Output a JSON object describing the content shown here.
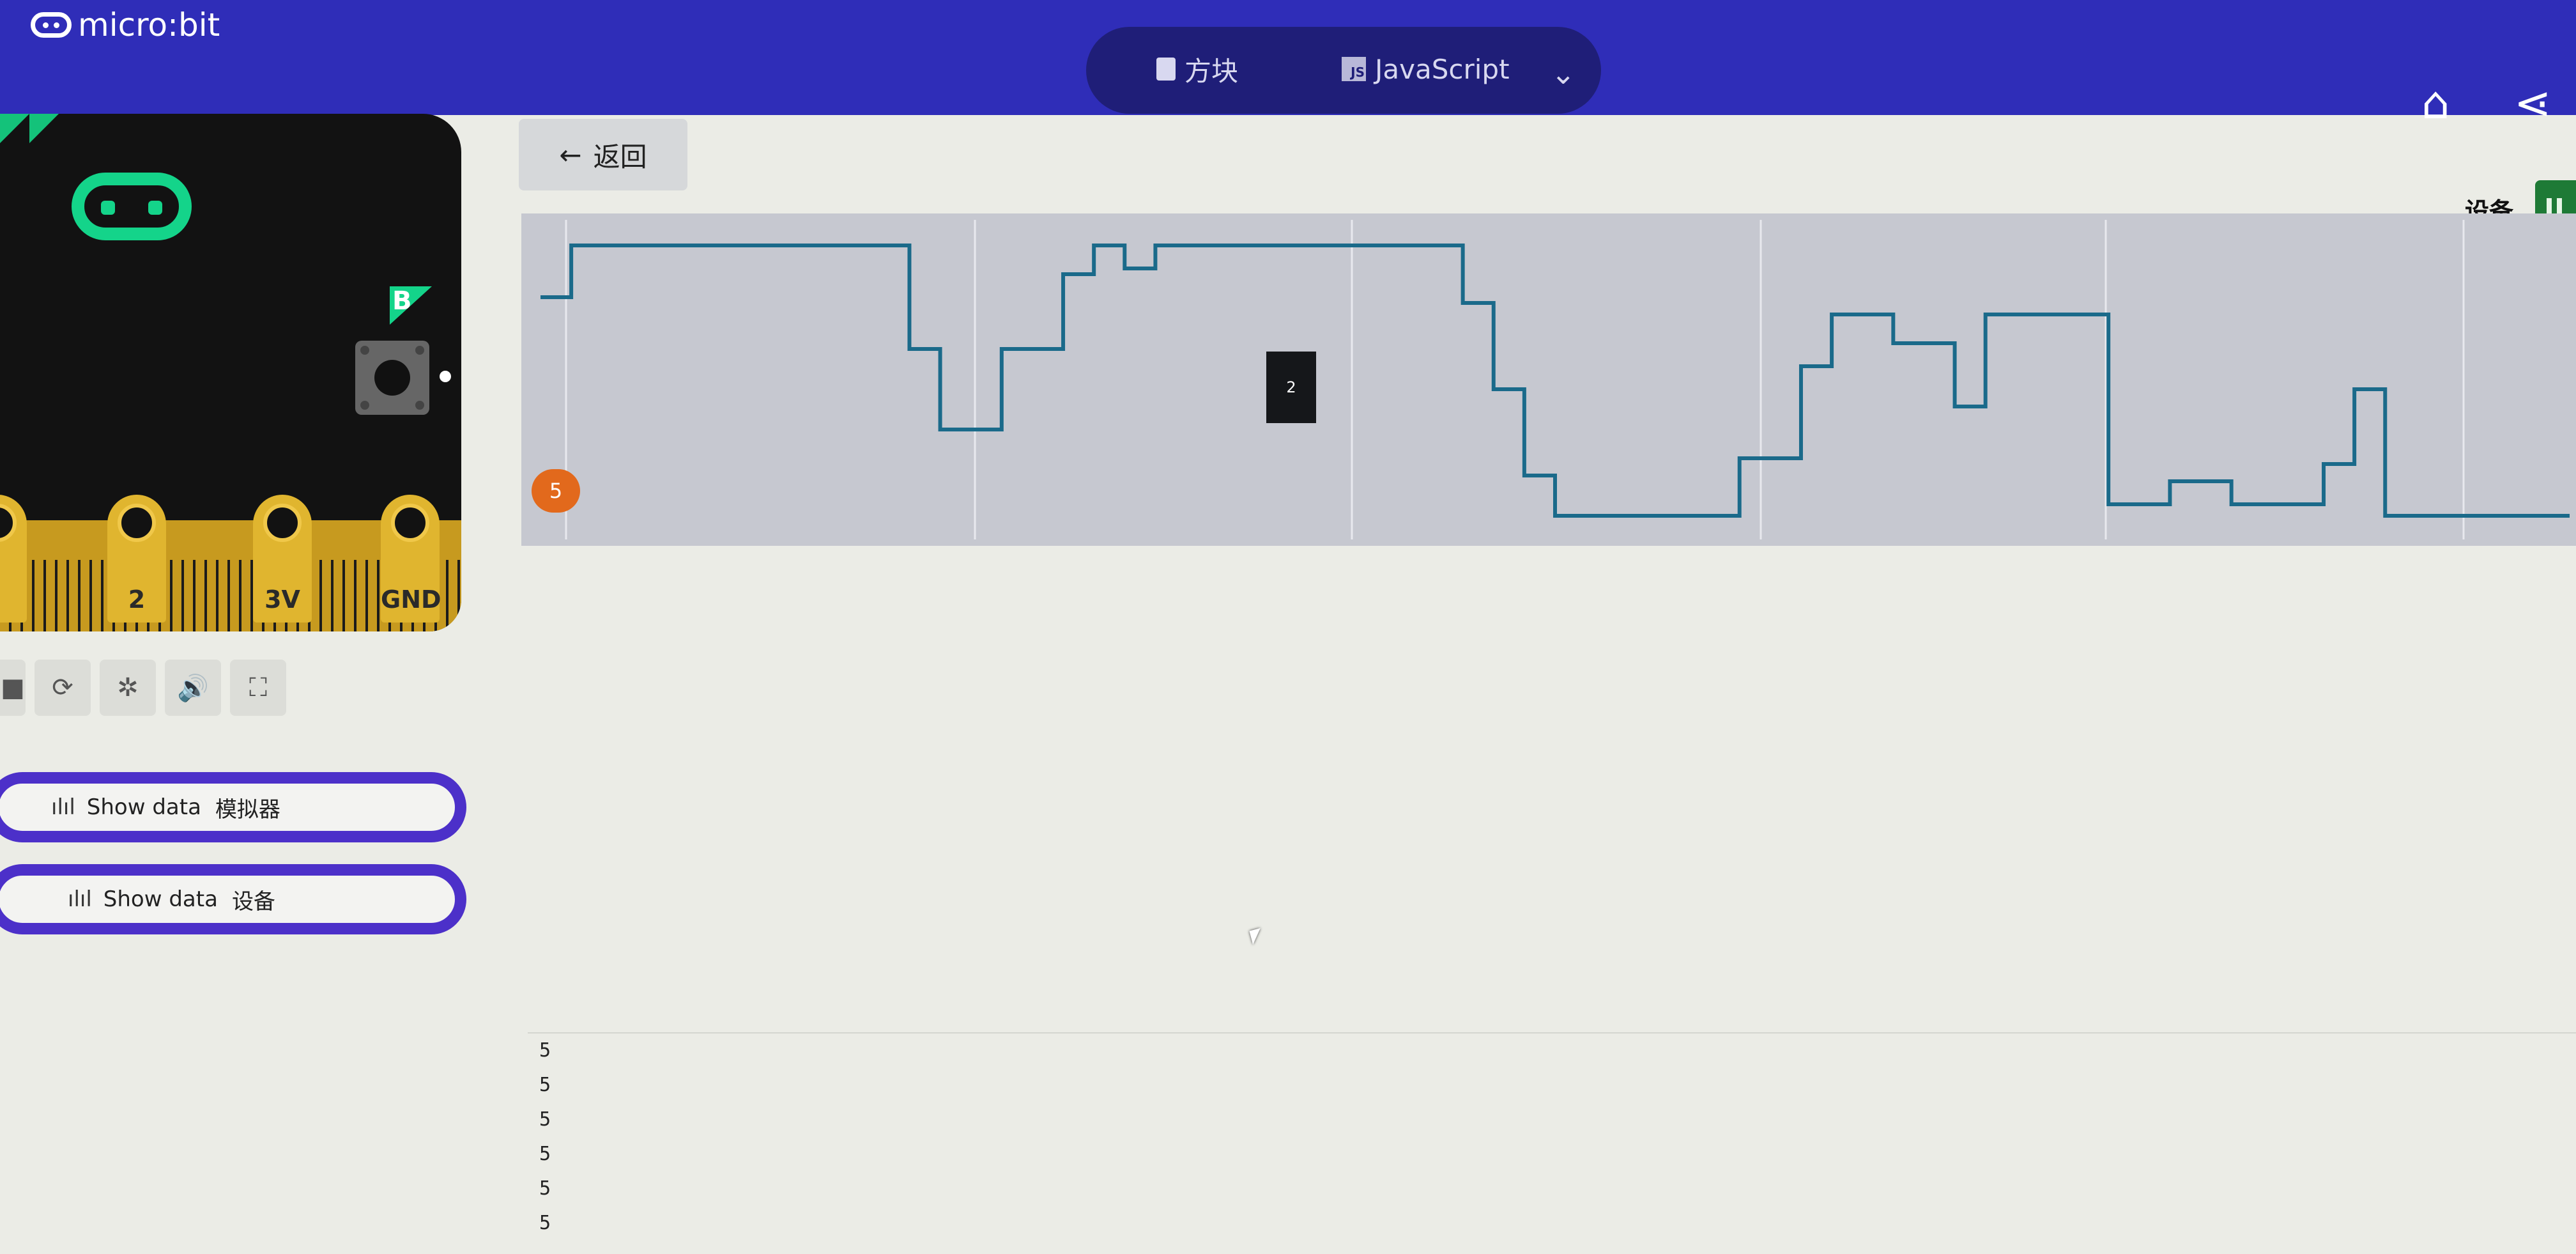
{
  "app": {
    "logo_text": "micro:bit"
  },
  "header": {
    "modes": [
      {
        "label": "方块",
        "icon": "puzzle-piece-icon"
      },
      {
        "label": "JavaScript",
        "icon": "js-icon"
      }
    ],
    "icons": [
      "home-icon",
      "share-icon"
    ]
  },
  "simulator": {
    "button_b_label": "B",
    "pins": [
      "2",
      "3V",
      "GND"
    ],
    "toolbar_icons": [
      "stop-icon",
      "restart-icon",
      "debug-icon",
      "sound-icon",
      "fullscreen-icon"
    ]
  },
  "sidebar": {
    "show_data_simulator": {
      "label": "Show data",
      "source": "模拟器"
    },
    "show_data_device": {
      "label": "Show data",
      "source": "设备"
    }
  },
  "main": {
    "back_label": "返回",
    "device_label": "设备"
  },
  "chart_data": {
    "type": "line",
    "title": "",
    "xlabel": "",
    "ylabel": "",
    "series": [
      {
        "values": [
          4.1,
          5,
          5,
          5,
          5,
          5,
          5,
          5,
          5,
          5,
          5,
          5,
          3.2,
          1.8,
          1.8,
          3.2,
          3.2,
          4.5,
          5,
          4.6,
          5,
          5,
          5,
          5,
          5,
          5,
          5,
          5,
          5,
          5,
          4,
          2.5,
          1,
          0.3,
          0.3,
          0.3,
          0.3,
          0.3,
          0.3,
          1.3,
          1.3,
          2.9,
          3.8,
          3.8,
          3.3,
          3.3,
          2.2,
          3.8,
          3.8,
          3.8,
          3.8,
          0.5,
          0.5,
          0.9,
          0.9,
          0.5,
          0.5,
          0.5,
          1.2,
          2.5,
          0.3,
          0.3,
          0.3,
          0.3,
          0.3,
          0.3,
          0.3
        ]
      }
    ],
    "legend_badge": "5",
    "tooltip_value": "2",
    "grid": true
  },
  "console": {
    "lines": [
      "5",
      "5",
      "5",
      "5",
      "5",
      "5"
    ]
  },
  "colors": {
    "header": "#2f2db8",
    "mode_switch": "#1f1e78",
    "line": "#1a6a8a",
    "badge": "#e2691c",
    "show_data_border": "#4c30c9",
    "device_toggle": "#1e7a36"
  }
}
